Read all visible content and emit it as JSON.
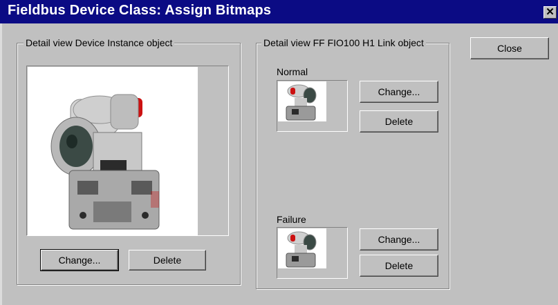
{
  "window": {
    "title": "Fieldbus Device Class: Assign Bitmaps",
    "close_glyph": "✕"
  },
  "device_group": {
    "legend": "Detail view Device Instance object",
    "change_label": "Change...",
    "delete_label": "Delete"
  },
  "link_group": {
    "legend": "Detail view FF FIO100 H1 Link object",
    "normal": {
      "label": "Normal",
      "change_label": "Change...",
      "delete_label": "Delete"
    },
    "failure": {
      "label": "Failure",
      "change_label": "Change...",
      "delete_label": "Delete"
    }
  },
  "close_button": {
    "label": "Close"
  },
  "colors": {
    "titlebar": "#0b0b84",
    "face": "#c0c0c0",
    "status_red": "#cc1111"
  },
  "icons": {
    "device_bitmap": "field-transmitter-icon"
  }
}
